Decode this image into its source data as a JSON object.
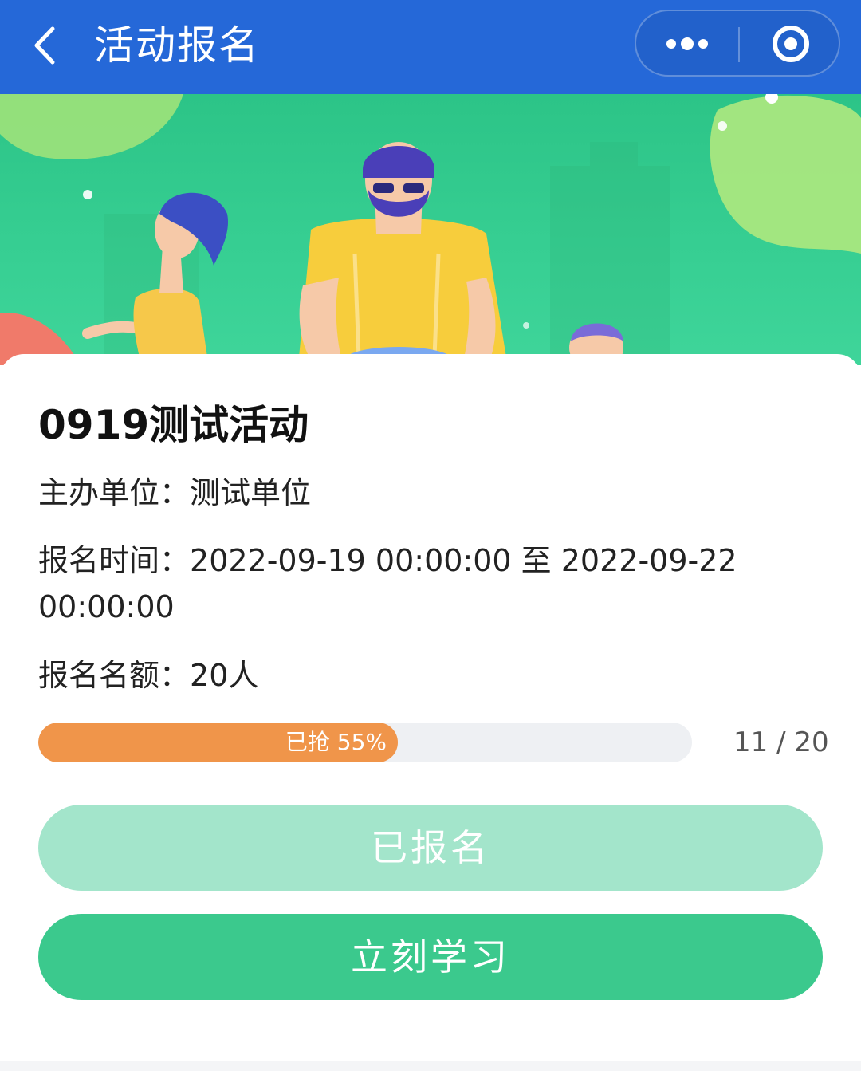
{
  "header": {
    "title": "活动报名",
    "background": "#2568d8",
    "back_icon": "chevron-left-icon",
    "more_icon": "more-dots-icon",
    "close_icon": "target-circle-icon"
  },
  "banner": {
    "image": "sports-people-illustration",
    "background": "#37cf93"
  },
  "activity": {
    "title": "0919测试活动",
    "organizer_label": "主办单位：",
    "organizer_value": "测试单位",
    "time_label": "报名时间：",
    "time_value": "2022-09-19 00:00:00 至 2022-09-22 00:00:00",
    "quota_label": "报名名额：",
    "quota_value": "20人"
  },
  "progress": {
    "label": "已抢 55%",
    "percent": 55,
    "count": "11 / 20",
    "fill_color": "#f0954a"
  },
  "buttons": {
    "registered_label": "已报名",
    "study_label": "立刻学习",
    "registered_color": "#a3e5cb",
    "study_color": "#3bc98d"
  }
}
